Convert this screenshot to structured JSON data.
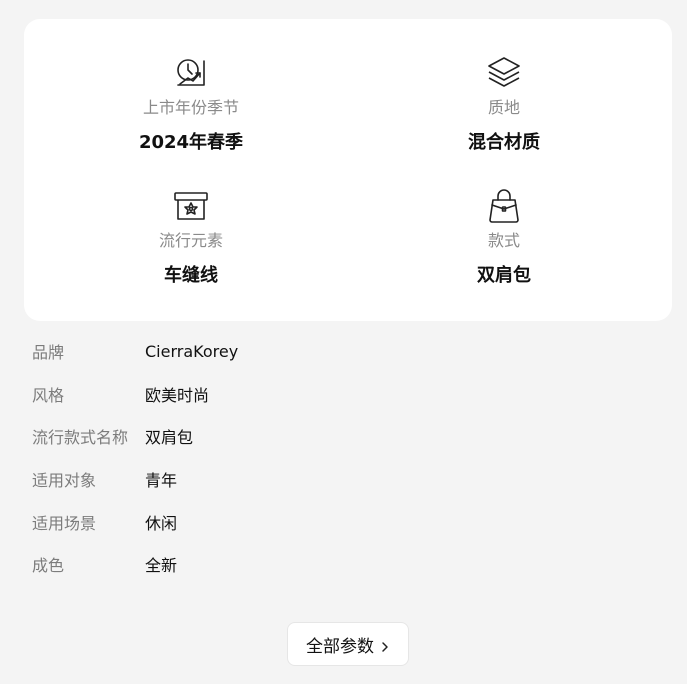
{
  "features": [
    {
      "icon": "calendar-season-icon",
      "label": "上市年份季节",
      "value": "2024年春季"
    },
    {
      "icon": "layers-icon",
      "label": "质地",
      "value": "混合材质"
    },
    {
      "icon": "trend-box-icon",
      "label": "流行元素",
      "value": "车缝线"
    },
    {
      "icon": "handbag-icon",
      "label": "款式",
      "value": "双肩包"
    }
  ],
  "params": [
    {
      "key": "品牌",
      "value": "CierraKorey"
    },
    {
      "key": "风格",
      "value": "欧美时尚"
    },
    {
      "key": "流行款式名称",
      "value": "双肩包"
    },
    {
      "key": "适用对象",
      "value": "青年"
    },
    {
      "key": "适用场景",
      "value": "休闲"
    },
    {
      "key": "成色",
      "value": "全新"
    }
  ],
  "all_params_button": {
    "label": "全部参数",
    "icon": "chevron-right-icon"
  }
}
